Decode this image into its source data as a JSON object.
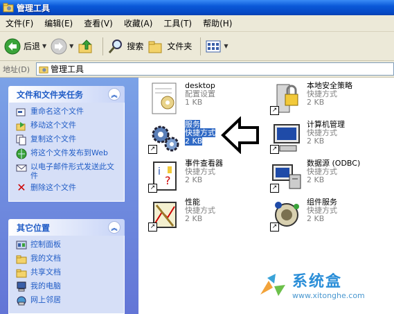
{
  "window": {
    "title": "管理工具"
  },
  "menu": [
    "文件(F)",
    "编辑(E)",
    "查看(V)",
    "收藏(A)",
    "工具(T)",
    "帮助(H)"
  ],
  "toolbar": {
    "back": "后退",
    "search": "搜索",
    "folders": "文件夹"
  },
  "address": {
    "label": "地址(D)",
    "value": "管理工具"
  },
  "tasks_panel": {
    "title": "文件和文件夹任务",
    "items": [
      {
        "label": "重命名这个文件"
      },
      {
        "label": "移动这个文件"
      },
      {
        "label": "复制这个文件"
      },
      {
        "label": "将这个文件发布到Web"
      },
      {
        "label": "以电子邮件形式发送此文件"
      },
      {
        "label": "删除这个文件"
      }
    ]
  },
  "places_panel": {
    "title": "其它位置",
    "items": [
      {
        "label": "控制面板"
      },
      {
        "label": "我的文档"
      },
      {
        "label": "共享文档"
      },
      {
        "label": "我的电脑"
      },
      {
        "label": "网上邻居"
      }
    ]
  },
  "files": [
    {
      "name": "desktop",
      "type": "配置设置",
      "size": "1 KB"
    },
    {
      "name": "本地安全策略",
      "type": "快捷方式",
      "size": "2 KB"
    },
    {
      "name": "服务",
      "type": "快捷方式",
      "size": "2 KB"
    },
    {
      "name": "计算机管理",
      "type": "快捷方式",
      "size": "2 KB"
    },
    {
      "name": "事件查看器",
      "type": "快捷方式",
      "size": "2 KB"
    },
    {
      "name": "数据源 (ODBC)",
      "type": "快捷方式",
      "size": "2 KB"
    },
    {
      "name": "性能",
      "type": "快捷方式",
      "size": "2 KB"
    },
    {
      "name": "组件服务",
      "type": "快捷方式",
      "size": "2 KB"
    }
  ],
  "watermark": {
    "title": "系统盒",
    "url": "www.xitonghe.com"
  },
  "colors": {
    "titlebar": "#0a58d8",
    "taskpane": "#6f8fe0",
    "link": "#215dc6",
    "selection": "#316ac5"
  }
}
